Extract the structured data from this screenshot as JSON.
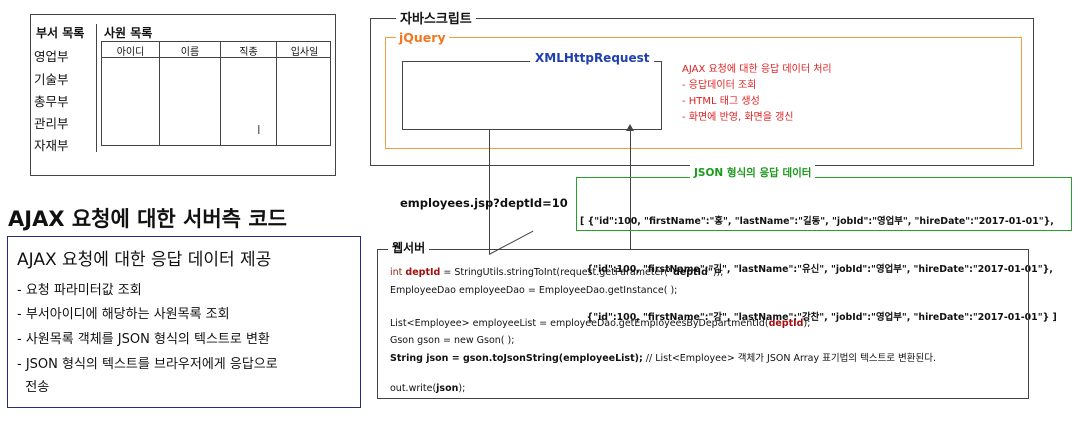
{
  "browser_ui": {
    "dept_list_title": "부서 목록",
    "departments": [
      "영업부",
      "기술부",
      "총무부",
      "관리부",
      "자재부"
    ],
    "employee_list_title": "사원 목록",
    "columns": [
      "아이디",
      "이름",
      "직종",
      "입사일"
    ]
  },
  "javascript": {
    "label": "자바스크립트",
    "jquery_label": "jQuery",
    "xhr_label": "XMLHttpRequest",
    "notes": [
      "AJAX 요청에 대한 응답 데이터 처리",
      "- 응답데이터 조회",
      "- HTML 태그 생성",
      "- 화면에 반영, 화면을 갱신"
    ]
  },
  "request_url": "employees.jsp?deptId=10",
  "json_response": {
    "label": "JSON 형식의 응답 데이터",
    "lines": [
      "[ {\"id\":100, \"firstName\":\"홍\", \"lastName\":\"길동\", \"jobId\":\"영업부\", \"hireDate\":\"2017-01-01\"},",
      "  {\"id\":100, \"firstName\":\"김\", \"lastName\":\"유신\", \"jobId\":\"영업부\", \"hireDate\":\"2017-01-01\"},",
      "  {\"id\":100, \"firstName\":\"강\", \"lastName\":\"강찬\", \"jobId\":\"영업부\", \"hireDate\":\"2017-01-01\"} ]"
    ]
  },
  "heading": "AJAX 요청에 대한 서버측 코드",
  "info": {
    "title": "AJAX 요청에 대한 응답 데이터 제공",
    "items": [
      "- 요청 파라미터값 조회",
      "- 부서아이디에 해당하는 사원목록 조회",
      "- 사원목록 객체를 JSON 형식의 텍스트로 변환",
      "- JSON 형식의 텍스트를 브라우저에게 응답으로",
      "  전송"
    ]
  },
  "server": {
    "label": "웹서버",
    "code": {
      "l1_a": "int ",
      "l1_var": "deptId",
      "l1_b": " = StringUtils.stringToInt(request.getParameter(",
      "l1_str": "\"deptId\"",
      "l1_c": "));",
      "l2": "EmployeeDao employeeDao = EmployeeDao.getInstance( );",
      "l3_a": "List<Employee> employeeList = employeeDao.getEmployeesByDepartmentId(",
      "l3_var": "deptId",
      "l3_b": ");",
      "l4": "Gson gson = new Gson( );",
      "l5_a": "String json = gson.toJsonString(employeeList);",
      "l5_b": " // List<Employee> 객체가 JSON Array 표기법의 텍스트로 변환된다.",
      "l6_a": "out.write(",
      "l6_b": "json",
      "l6_c": ");"
    }
  },
  "colors": {
    "jquery": "#f07820",
    "xhr": "#2040b0",
    "notes": "#e02020",
    "json_border": "#2aa02a",
    "info_border": "#2a2a7a"
  }
}
